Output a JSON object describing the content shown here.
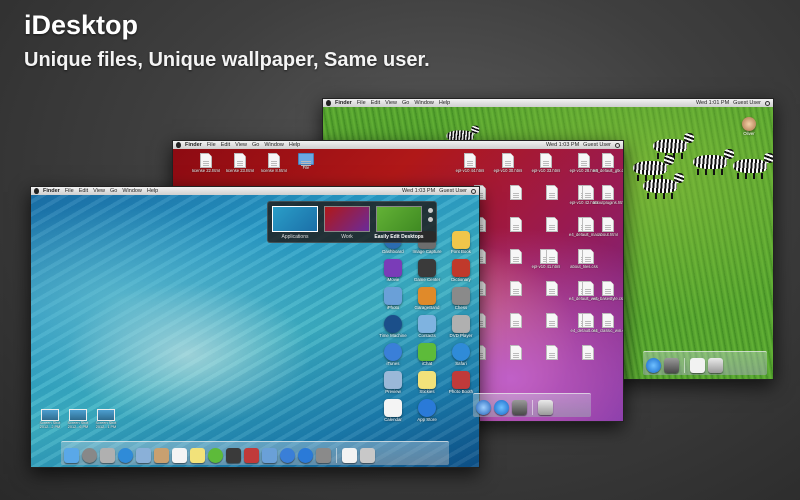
{
  "header": {
    "title": "iDesktop",
    "subtitle": "Unique files, Unique wallpaper, Same user."
  },
  "colors": {
    "background": "#3f3f3f",
    "menubar": "#e6e6e6",
    "front_wallpaper": "#2a9ec8",
    "mid_wallpaper": "#b01818",
    "back_wallpaper": "#4f9a2c"
  },
  "back_desktop": {
    "menu": [
      "Finder",
      "File",
      "Edit",
      "View",
      "Go",
      "Window",
      "Help"
    ],
    "clock": "Wed 1:01 PM",
    "user": "Guest User",
    "icon_label": "Oliver"
  },
  "mid_desktop": {
    "menu": [
      "Finder",
      "File",
      "Edit",
      "View",
      "Go",
      "Window",
      "Help"
    ],
    "clock": "Wed 1:03 PM",
    "user": "Guest User",
    "files": [
      {
        "label": "license 22.html"
      },
      {
        "label": "license 23.html"
      },
      {
        "label": "license 8.html"
      },
      {
        "label": "File",
        "folder": true
      },
      {
        "label": "epl-v10 44.html"
      },
      {
        "label": "epl-v10 30.html"
      },
      {
        "label": "epl-v10 33.html"
      },
      {
        "label": "epl-v10 28.html"
      },
      {
        "label": "e4_default_gtk.css"
      },
      {
        "label": "aboutplugins.html"
      },
      {
        "label": "epl-v10 42.html"
      },
      {
        "label": "e4_default_mac.css"
      },
      {
        "label": "about.html"
      },
      {
        "label": "epl-v10 41.html"
      },
      {
        "label": "about_files.css"
      },
      {
        "label": "e4_default_win.css"
      },
      {
        "label": "e4_basestyle.css"
      },
      {
        "label": "e4_default.css"
      },
      {
        "label": "e4_classic_win.css"
      }
    ]
  },
  "front_desktop": {
    "menu": [
      "Finder",
      "File",
      "Edit",
      "View",
      "Go",
      "Window",
      "Help"
    ],
    "clock": "Wed 1:03 PM",
    "user": "Guest User",
    "switcher": {
      "items": [
        "Applications",
        "Work",
        "Easily Edit Desktops"
      ]
    },
    "apps": [
      "Dashboard",
      "Image Capture",
      "Font Book",
      "iMovie",
      "Game Center",
      "Dictionary",
      "iPhoto",
      "GarageBand",
      "Chess",
      "Time Machine",
      "Contacts",
      "DVD Player",
      "iTunes",
      "iChat",
      "Safari",
      "Preview",
      "Stickies",
      "Photo Booth",
      "Calendar",
      "App Store"
    ],
    "screenshots": [
      {
        "label": "Screen Shot 2012...2 PM"
      },
      {
        "label": "Screen Shot 2012...6 PM"
      },
      {
        "label": "Screen Shot 2012...1 PM"
      }
    ]
  }
}
